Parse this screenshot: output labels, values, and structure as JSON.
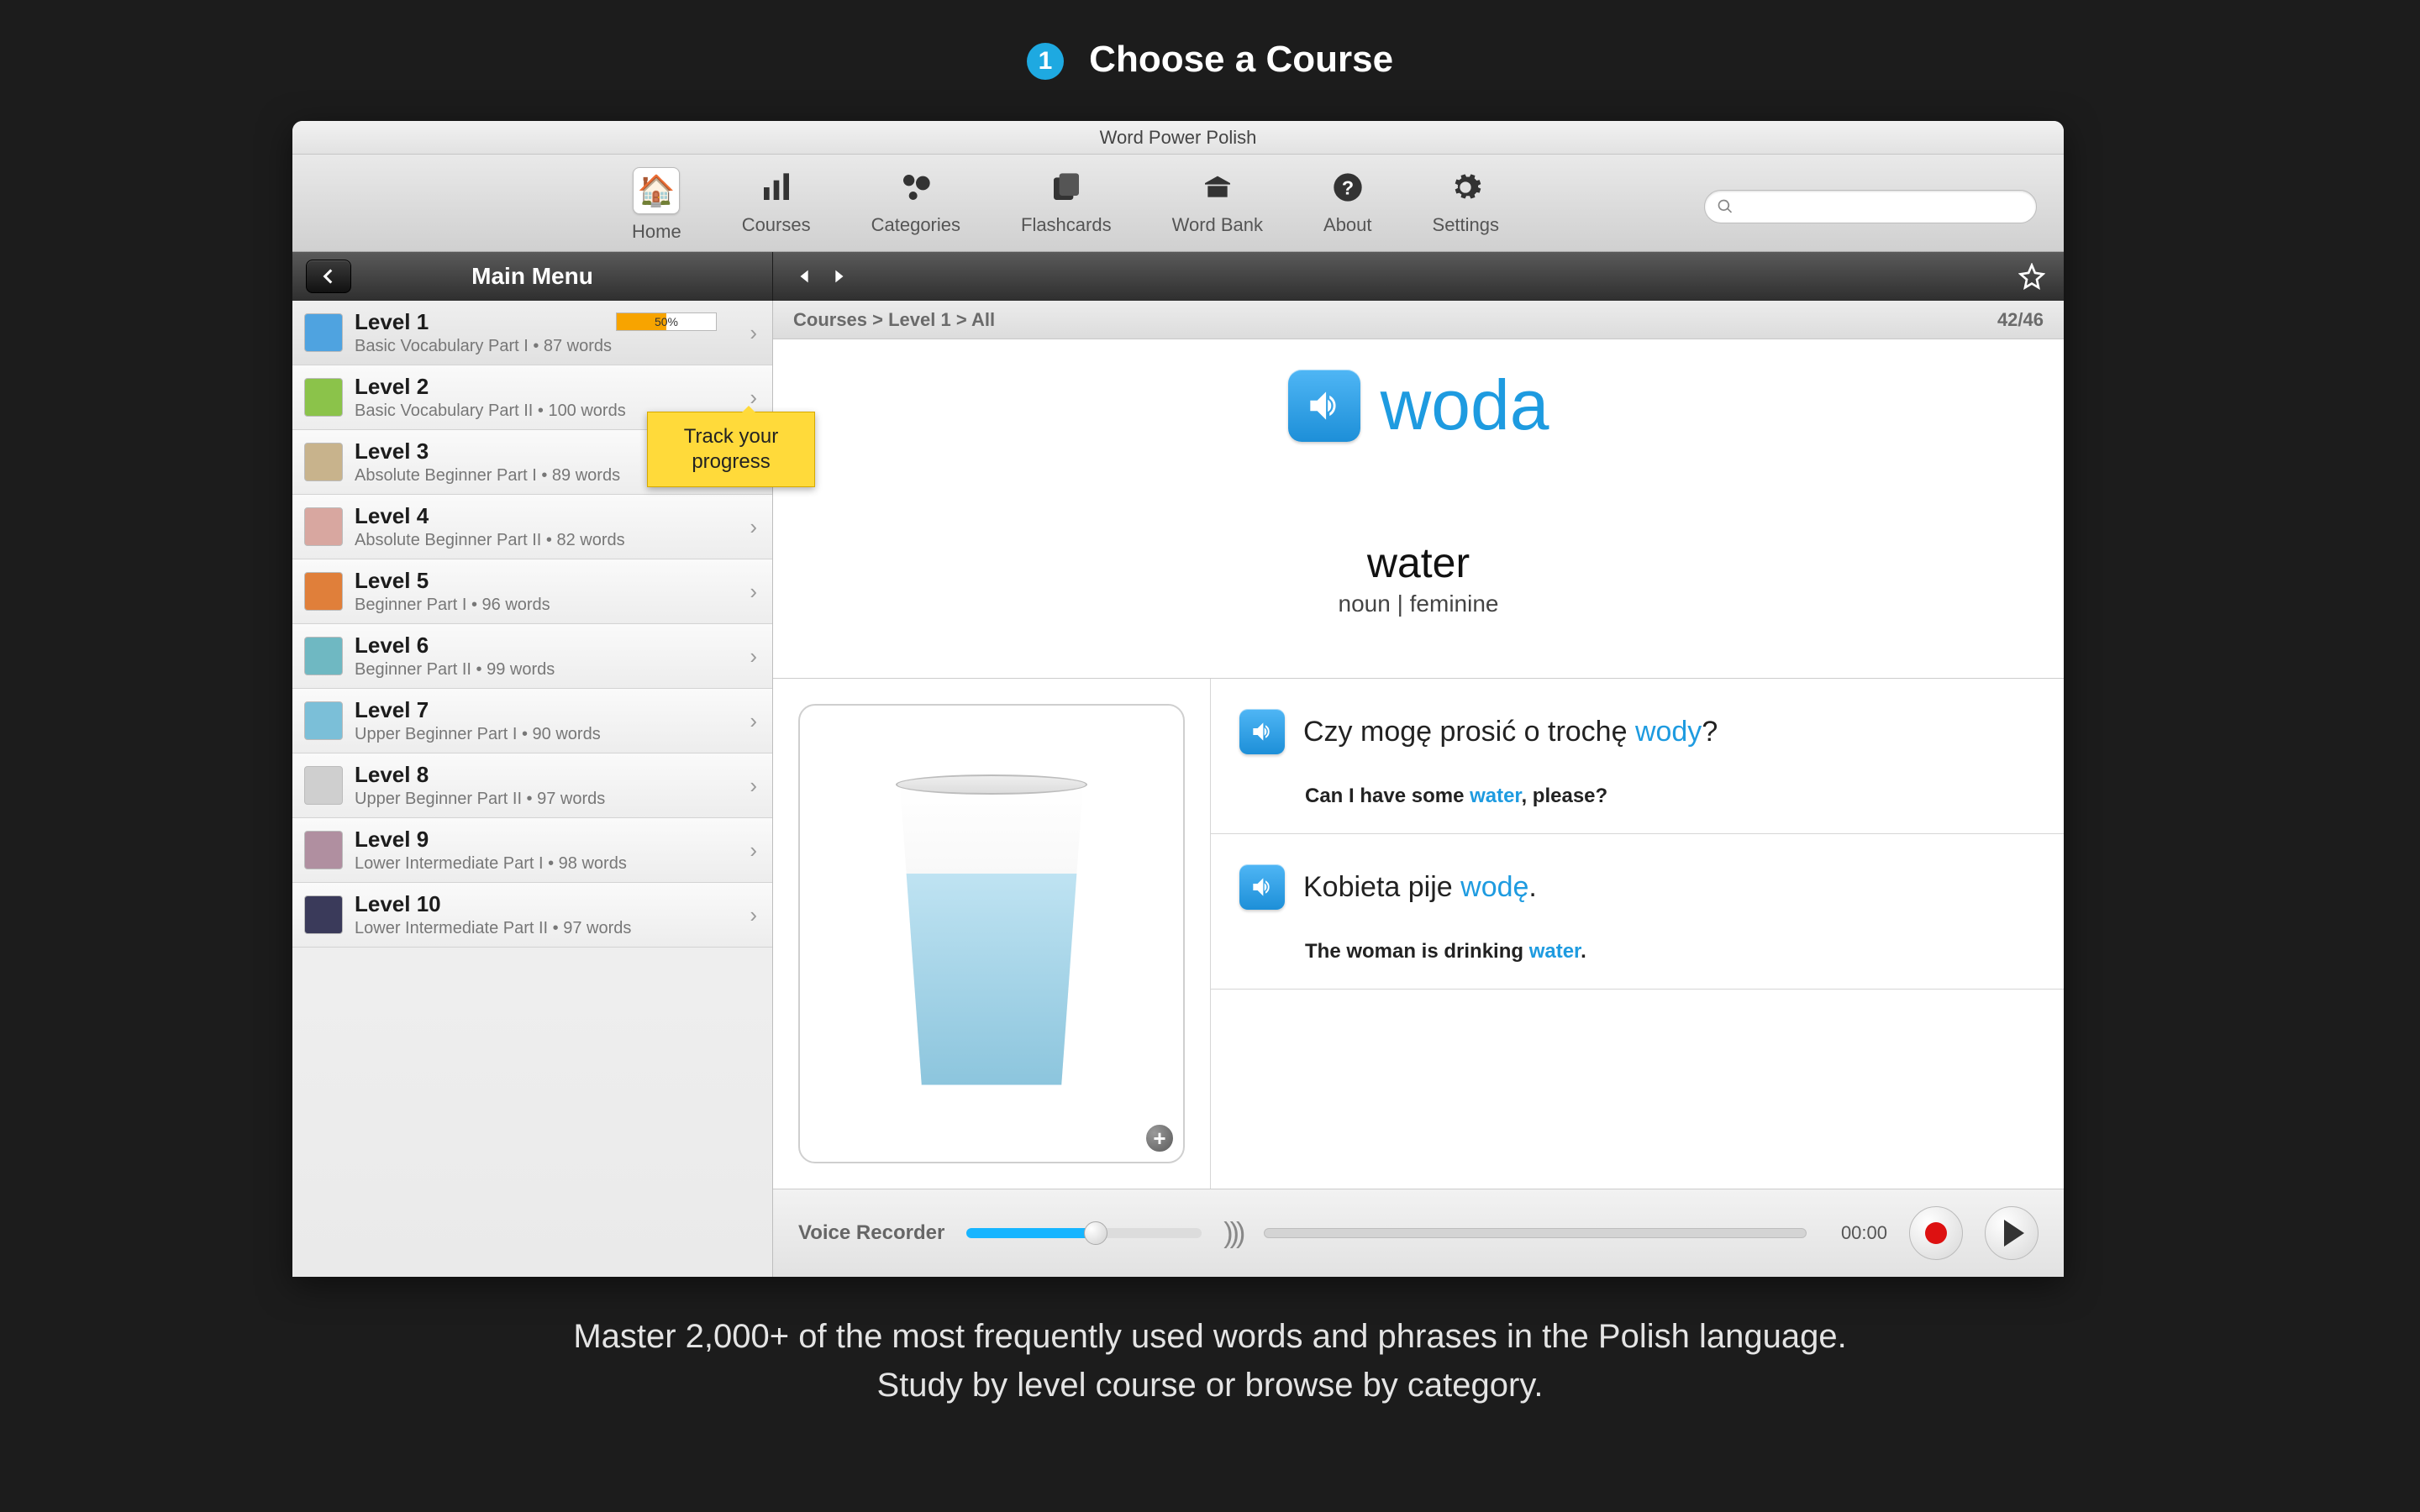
{
  "page": {
    "step_number": "1",
    "step_title": "Choose a Course",
    "tagline_1": "Master 2,000+ of the most frequently used words and phrases in the Polish language.",
    "tagline_2": "Study by level course or browse by category."
  },
  "window": {
    "title": "Word Power Polish"
  },
  "toolbar": {
    "home": "Home",
    "courses": "Courses",
    "categories": "Categories",
    "flashcards": "Flashcards",
    "wordbank": "Word Bank",
    "about": "About",
    "settings": "Settings",
    "search_placeholder": ""
  },
  "sidebar": {
    "header": "Main Menu",
    "callout_l1": "Track your",
    "callout_l2": "progress",
    "levels": [
      {
        "title": "Level 1",
        "sub": "Basic Vocabulary Part I • 87 words",
        "progress_pct": "50%",
        "selected": true
      },
      {
        "title": "Level 2",
        "sub": "Basic Vocabulary Part II • 100 words",
        "selected": false
      },
      {
        "title": "Level 3",
        "sub": "Absolute Beginner Part I • 89 words",
        "selected": false
      },
      {
        "title": "Level 4",
        "sub": "Absolute Beginner Part II • 82 words",
        "selected": false
      },
      {
        "title": "Level 5",
        "sub": "Beginner Part I • 96 words",
        "selected": false
      },
      {
        "title": "Level 6",
        "sub": "Beginner Part II • 99 words",
        "selected": false
      },
      {
        "title": "Level 7",
        "sub": "Upper Beginner Part I • 90 words",
        "selected": false
      },
      {
        "title": "Level 8",
        "sub": "Upper Beginner Part II • 97 words",
        "selected": false
      },
      {
        "title": "Level 9",
        "sub": "Lower Intermediate Part I • 98 words",
        "selected": false
      },
      {
        "title": "Level 10",
        "sub": "Lower Intermediate Part II • 97 words",
        "selected": false
      }
    ]
  },
  "content": {
    "breadcrumb": "Courses > Level 1 > All",
    "counter": "42/46",
    "word": "woda",
    "translation": "water",
    "grammar": "noun | feminine",
    "img_alt": "glass of water",
    "examples": [
      {
        "pl_pre": "Czy mogę prosić o trochę ",
        "pl_hl": "wody",
        "pl_post": "?",
        "en_pre": "Can I have some ",
        "en_hl": "water",
        "en_post": ", please?"
      },
      {
        "pl_pre": "Kobieta pije ",
        "pl_hl": "wodę",
        "pl_post": ".",
        "en_pre": "The woman is drinking ",
        "en_hl": "water",
        "en_post": "."
      }
    ]
  },
  "recorder": {
    "label": "Voice Recorder",
    "time": "00:00"
  },
  "colors": {
    "accent": "#1e9be0",
    "callout": "#ffda3a"
  }
}
